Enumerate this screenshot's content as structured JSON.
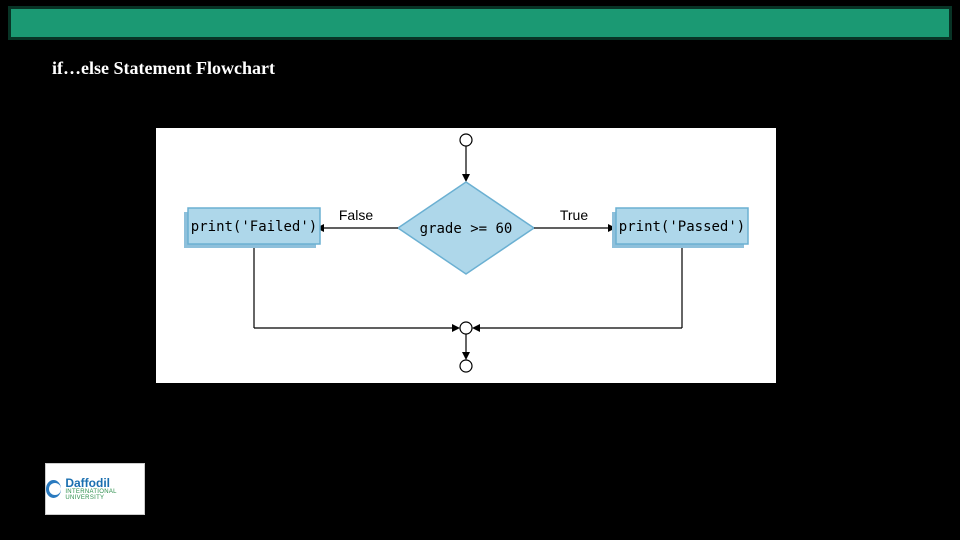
{
  "slide": {
    "title": "if…else Statement Flowchart"
  },
  "flowchart": {
    "condition": "grade >= 60",
    "true_label": "True",
    "false_label": "False",
    "true_action": "print('Passed')",
    "false_action": "print('Failed')"
  },
  "logo": {
    "name": "Daffodil",
    "subtitle": "INTERNATIONAL UNIVERSITY"
  }
}
